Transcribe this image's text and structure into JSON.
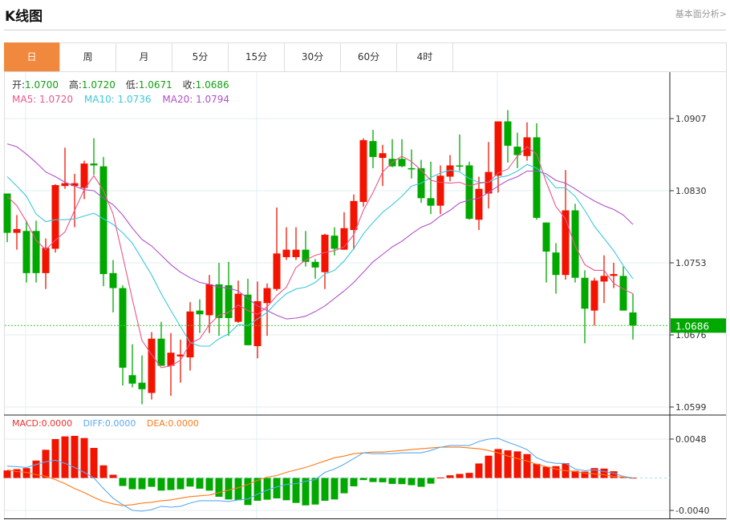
{
  "header": {
    "title": "K线图",
    "link": "基本面分析>"
  },
  "tabs": [
    {
      "label": "日",
      "active": true
    },
    {
      "label": "周"
    },
    {
      "label": "月"
    },
    {
      "label": "5分"
    },
    {
      "label": "15分"
    },
    {
      "label": "30分"
    },
    {
      "label": "60分"
    },
    {
      "label": "4时"
    }
  ],
  "ohlc_info": {
    "open_label": "开:",
    "open": "1.0700",
    "high_label": "高:",
    "high": "1.0720",
    "low_label": "低:",
    "low": "1.0671",
    "close_label": "收:",
    "close": "1.0686"
  },
  "ma_info": {
    "ma5": "MA5: 1.0720",
    "ma10": "MA10: 1.0736",
    "ma20": "MA20: 1.0794"
  },
  "macd_info": {
    "macd": "MACD:0.0000",
    "diff": "DIFF:0.0000",
    "dea": "DEA:0.0000"
  },
  "colors": {
    "up": "#f21400",
    "down": "#00a800",
    "ma5": "#e8578a",
    "ma10": "#3cc8dc",
    "ma20": "#b050c8",
    "diff": "#5aaaf0",
    "dea": "#ff7a1a",
    "accent": "#f0883e"
  },
  "chart_data": [
    {
      "type": "candlestick",
      "title": "K线图",
      "ylim": [
        1.0599,
        1.0907
      ],
      "y_ticks": [
        "1.0907",
        "1.0830",
        "1.0753",
        "1.0676",
        "1.0599"
      ],
      "current_price": "1.0686",
      "ohlc": [
        [
          1.0827,
          1.0827,
          1.0775,
          1.0785
        ],
        [
          1.0785,
          1.0804,
          1.0767,
          1.0789
        ],
        [
          1.0787,
          1.0798,
          1.0732,
          1.0742
        ],
        [
          1.0787,
          1.0798,
          1.0732,
          1.0742
        ],
        [
          1.0742,
          1.0779,
          1.0725,
          1.0769
        ],
        [
          1.0768,
          1.0837,
          1.0764,
          1.0836
        ],
        [
          1.0835,
          1.0876,
          1.0832,
          1.0838
        ],
        [
          1.0835,
          1.0848,
          1.0791,
          1.0838
        ],
        [
          1.0833,
          1.0862,
          1.0821,
          1.0859
        ],
        [
          1.0859,
          1.0886,
          1.0847,
          1.0857
        ],
        [
          1.0856,
          1.0866,
          1.0728,
          1.0741
        ],
        [
          1.0742,
          1.0756,
          1.07,
          1.0726
        ],
        [
          1.0726,
          1.0729,
          1.0622,
          1.0641
        ],
        [
          1.0633,
          1.0666,
          1.062,
          1.0624
        ],
        [
          1.0625,
          1.0654,
          1.0602,
          1.0618
        ],
        [
          1.0614,
          1.0679,
          1.0607,
          1.0672
        ],
        [
          1.0672,
          1.069,
          1.0643,
          1.0643
        ],
        [
          1.0643,
          1.0678,
          1.0611,
          1.0657
        ],
        [
          1.0653,
          1.0671,
          1.0625,
          1.0655
        ],
        [
          1.0652,
          1.0711,
          1.0638,
          1.0701
        ],
        [
          1.0702,
          1.0714,
          1.0678,
          1.0698
        ],
        [
          1.0697,
          1.074,
          1.0678,
          1.073
        ],
        [
          1.073,
          1.0753,
          1.0675,
          1.0694
        ],
        [
          1.0729,
          1.0754,
          1.0675,
          1.0694
        ],
        [
          1.069,
          1.0734,
          1.0689,
          1.072
        ],
        [
          1.0719,
          1.0736,
          1.0665,
          1.0665
        ],
        [
          1.0664,
          1.0733,
          1.0651,
          1.0712
        ],
        [
          1.071,
          1.0731,
          1.0675,
          1.0726
        ],
        [
          1.0725,
          1.0812,
          1.0723,
          1.0763
        ],
        [
          1.0759,
          1.0791,
          1.0756,
          1.0767
        ],
        [
          1.0759,
          1.0791,
          1.0756,
          1.0767
        ],
        [
          1.0767,
          1.0787,
          1.0749,
          1.0754
        ],
        [
          1.0754,
          1.0757,
          1.0736,
          1.0748
        ],
        [
          1.0743,
          1.0784,
          1.0725,
          1.0783
        ],
        [
          1.0782,
          1.0791,
          1.0761,
          1.0768
        ],
        [
          1.0767,
          1.0807,
          1.0767,
          1.079
        ],
        [
          1.0788,
          1.0826,
          1.0767,
          1.0819
        ],
        [
          1.0818,
          1.0886,
          1.0813,
          1.0884
        ],
        [
          1.0883,
          1.0895,
          1.0854,
          1.0866
        ],
        [
          1.0865,
          1.0879,
          1.0835,
          1.087
        ],
        [
          1.0864,
          1.0885,
          1.0855,
          1.0856
        ],
        [
          1.0864,
          1.0885,
          1.0855,
          1.0856
        ],
        [
          1.0854,
          1.0874,
          1.0843,
          1.0853
        ],
        [
          1.0854,
          1.0863,
          1.0817,
          1.0822
        ],
        [
          1.0822,
          1.0861,
          1.0805,
          1.0814
        ],
        [
          1.0814,
          1.0857,
          1.0805,
          1.0846
        ],
        [
          1.0845,
          1.0868,
          1.084,
          1.0857
        ],
        [
          1.0857,
          1.089,
          1.0851,
          1.0856
        ],
        [
          1.0857,
          1.0861,
          1.0799,
          1.08
        ],
        [
          1.0799,
          1.0845,
          1.0788,
          1.0832
        ],
        [
          1.0827,
          1.0882,
          1.0811,
          1.085
        ],
        [
          1.0846,
          1.0904,
          1.0828,
          1.0904
        ],
        [
          1.0904,
          1.0916,
          1.086,
          1.0878
        ],
        [
          1.0877,
          1.0892,
          1.0854,
          1.0868
        ],
        [
          1.0867,
          1.0903,
          1.0862,
          1.0887
        ],
        [
          1.0887,
          1.0902,
          1.0799,
          1.0801
        ],
        [
          1.0796,
          1.0796,
          1.0732,
          1.0765
        ],
        [
          1.0764,
          1.0774,
          1.072,
          1.074
        ],
        [
          1.074,
          1.0852,
          1.0735,
          1.0809
        ],
        [
          1.0809,
          1.0816,
          1.0732,
          1.0737
        ],
        [
          1.0737,
          1.0745,
          1.0667,
          1.0704
        ],
        [
          1.0702,
          1.0737,
          1.0686,
          1.0734
        ],
        [
          1.0733,
          1.0761,
          1.071,
          1.0739
        ],
        [
          1.0739,
          1.0753,
          1.0726,
          1.0741
        ],
        [
          1.0739,
          1.0749,
          1.0702,
          1.0702
        ],
        [
          1.07,
          1.072,
          1.0671,
          1.0686
        ]
      ],
      "ma5": [
        1.0824,
        1.0814,
        1.0797,
        1.0777,
        1.0767,
        1.0777,
        1.0786,
        1.0809,
        1.0831,
        1.0846,
        1.083,
        1.0805,
        1.076,
        1.0714,
        1.067,
        1.0655,
        1.0641,
        1.0643,
        1.0649,
        1.0667,
        1.0672,
        1.0687,
        1.0697,
        1.07,
        1.0708,
        1.0702,
        1.0698,
        1.0706,
        1.0718,
        1.0727,
        1.0748,
        1.0756,
        1.0761,
        1.0764,
        1.0766,
        1.077,
        1.0783,
        1.0809,
        1.0828,
        1.085,
        1.086,
        1.0867,
        1.0861,
        1.0852,
        1.0841,
        1.0839,
        1.0838,
        1.0839,
        1.0835,
        1.0838,
        1.0839,
        1.0849,
        1.0853,
        1.0867,
        1.0877,
        1.0869,
        1.0839,
        1.0813,
        1.08,
        1.0771,
        1.0751,
        1.0745,
        1.0745,
        1.0731,
        1.0725,
        1.072
      ],
      "ma10": [
        1.0845,
        1.0835,
        1.0824,
        1.0805,
        1.0797,
        1.0799,
        1.0799,
        1.08,
        1.0803,
        1.0806,
        1.08,
        1.0794,
        1.0785,
        1.0774,
        1.0757,
        1.074,
        1.072,
        1.0702,
        1.0685,
        1.0668,
        1.0664,
        1.0664,
        1.0672,
        1.0677,
        1.0687,
        1.0686,
        1.0693,
        1.07,
        1.0711,
        1.072,
        1.0725,
        1.0727,
        1.0732,
        1.0741,
        1.0745,
        1.0755,
        1.0768,
        1.0784,
        1.0796,
        1.0807,
        1.0815,
        1.0824,
        1.0835,
        1.0838,
        1.0844,
        1.0849,
        1.0852,
        1.085,
        1.0843,
        1.0839,
        1.0839,
        1.0844,
        1.0846,
        1.0851,
        1.0858,
        1.0854,
        1.0845,
        1.0833,
        1.0833,
        1.0824,
        1.0809,
        1.0792,
        1.0779,
        1.0766,
        1.075,
        1.0736
      ],
      "ma20": [
        1.088,
        1.0877,
        1.0869,
        1.086,
        1.085,
        1.0845,
        1.0839,
        1.0835,
        1.0831,
        1.083,
        1.0822,
        1.0815,
        1.0804,
        1.079,
        1.0778,
        1.0771,
        1.0761,
        1.0751,
        1.0743,
        1.0737,
        1.0732,
        1.073,
        1.0727,
        1.0726,
        1.0723,
        1.0715,
        1.0707,
        1.0702,
        1.0697,
        1.0693,
        1.0694,
        1.0696,
        1.0701,
        1.0707,
        1.0715,
        1.0723,
        1.0732,
        1.0743,
        1.0754,
        1.0762,
        1.077,
        1.0776,
        1.0784,
        1.0791,
        1.0795,
        1.0803,
        1.0809,
        1.0817,
        1.082,
        1.0822,
        1.0828,
        1.0835,
        1.0841,
        1.0845,
        1.0851,
        1.0851,
        1.0848,
        1.0841,
        1.0838,
        1.0832,
        1.0825,
        1.0819,
        1.0814,
        1.081,
        1.0804,
        1.0794
      ]
    },
    {
      "type": "bar+line",
      "title": "MACD",
      "ylim": [
        -0.004,
        0.0048
      ],
      "y_ticks": [
        "0.0048",
        "-0.0040"
      ],
      "macd": [
        0.00093,
        0.00109,
        0.00122,
        0.00215,
        0.00348,
        0.0048,
        0.00513,
        0.0052,
        0.00493,
        0.00371,
        0.00156,
        0.0004,
        -0.00099,
        -0.00139,
        -0.00139,
        -0.00109,
        -0.00156,
        -0.00149,
        -0.00139,
        -0.00106,
        -0.00132,
        -0.00156,
        -0.00232,
        -0.00265,
        -0.00275,
        -0.00334,
        -0.00281,
        -0.00268,
        -0.00252,
        -0.00275,
        -0.00308,
        -0.00338,
        -0.00328,
        -0.00281,
        -0.00265,
        -0.00189,
        -0.00103,
        -0.00026,
        -0.0005,
        -0.00053,
        -0.00073,
        -0.00076,
        -0.00089,
        -0.00109,
        -0.0007,
        5e-05,
        0.00033,
        0.0005,
        0.00063,
        0.00179,
        0.00275,
        0.00357,
        0.00341,
        0.00328,
        0.00295,
        0.00175,
        0.00139,
        0.00146,
        0.00182,
        0.00089,
        0.00079,
        0.00122,
        0.00116,
        0.00083,
        0.00017,
        3e-05
      ],
      "diff": [
        0.00146,
        0.0014,
        0.0013,
        0.00166,
        0.002,
        0.0022,
        0.0018,
        0.0013,
        0.0007,
        0.0,
        -0.0013,
        -0.0025,
        -0.0033,
        -0.004,
        -0.0041,
        -0.0039,
        -0.0035,
        -0.0036,
        -0.0035,
        -0.0031,
        -0.0028,
        -0.0028,
        -0.0028,
        -0.0029,
        -0.0027,
        -0.0026,
        -0.002,
        -0.0015,
        -0.0011,
        -0.0008,
        -0.0007,
        -0.0004,
        -0.0002,
        0.0007,
        0.0011,
        0.0017,
        0.0024,
        0.0031,
        0.003,
        0.003,
        0.003,
        0.0031,
        0.0031,
        0.0031,
        0.0034,
        0.0038,
        0.004,
        0.004,
        0.004,
        0.0045,
        0.0048,
        0.0049,
        0.0044,
        0.004,
        0.0035,
        0.0025,
        0.002,
        0.0018,
        0.0018,
        0.0011,
        0.0009,
        0.001,
        0.0008,
        0.0006,
        0.0002,
        0.0
      ],
      "dea": [
        0.001,
        0.0008,
        0.0007,
        0.0004,
        0.0002,
        -0.0002,
        -0.0007,
        -0.0013,
        -0.0018,
        -0.0024,
        -0.0029,
        -0.0032,
        -0.0034,
        -0.0033,
        -0.0031,
        -0.003,
        -0.0028,
        -0.0027,
        -0.0025,
        -0.0023,
        -0.0022,
        -0.0021,
        -0.0018,
        -0.0015,
        -0.0012,
        -0.0008,
        -0.0003,
        0.0001,
        0.0003,
        0.0007,
        0.001,
        0.0013,
        0.0017,
        0.0021,
        0.0025,
        0.0027,
        0.003,
        0.0031,
        0.0032,
        0.0032,
        0.0033,
        0.0034,
        0.0035,
        0.0036,
        0.0037,
        0.0038,
        0.0038,
        0.0038,
        0.0037,
        0.0036,
        0.0034,
        0.0031,
        0.0027,
        0.0024,
        0.0021,
        0.0017,
        0.0014,
        0.0011,
        0.0009,
        0.0008,
        0.0006,
        0.0005,
        0.0004,
        0.0002,
        0.0001,
        0.0
      ]
    }
  ]
}
